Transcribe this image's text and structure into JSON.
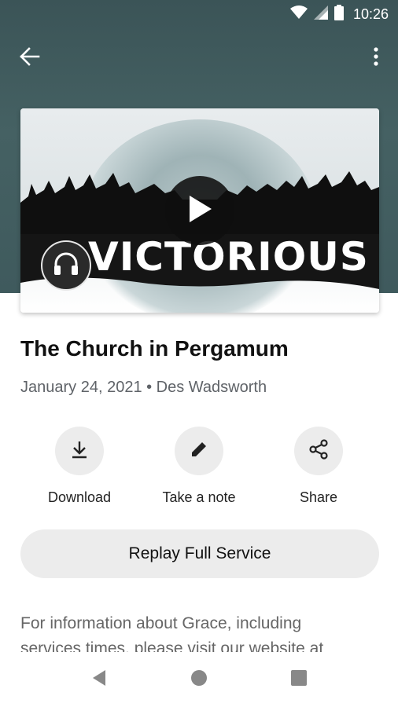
{
  "status_bar": {
    "time": "10:26",
    "icons": [
      "wifi-icon",
      "signal-icon",
      "battery-icon"
    ]
  },
  "toolbar": {
    "back_icon": "arrow-back-icon",
    "more_icon": "more-vert-icon"
  },
  "artwork": {
    "title_text": "VICTORIOUS",
    "play_icon": "play-icon",
    "audio_icon": "headphones-icon"
  },
  "sermon": {
    "title": "The Church in Pergamum",
    "meta": "January 24, 2021 • Des Wadsworth"
  },
  "actions": [
    {
      "label": "Download",
      "icon": "download-icon"
    },
    {
      "label": "Take a note",
      "icon": "pencil-icon"
    },
    {
      "label": "Share",
      "icon": "share-icon"
    }
  ],
  "replay_button": {
    "label": "Replay Full Service"
  },
  "description": {
    "text": "For information about Grace, including services times, please visit our website at"
  },
  "nav_bar": {
    "icons": [
      "back-triangle-icon",
      "home-circle-icon",
      "recents-square-icon"
    ]
  },
  "colors": {
    "header": "#456163",
    "button_bg": "#ececec",
    "meta_text": "#5f6368"
  }
}
